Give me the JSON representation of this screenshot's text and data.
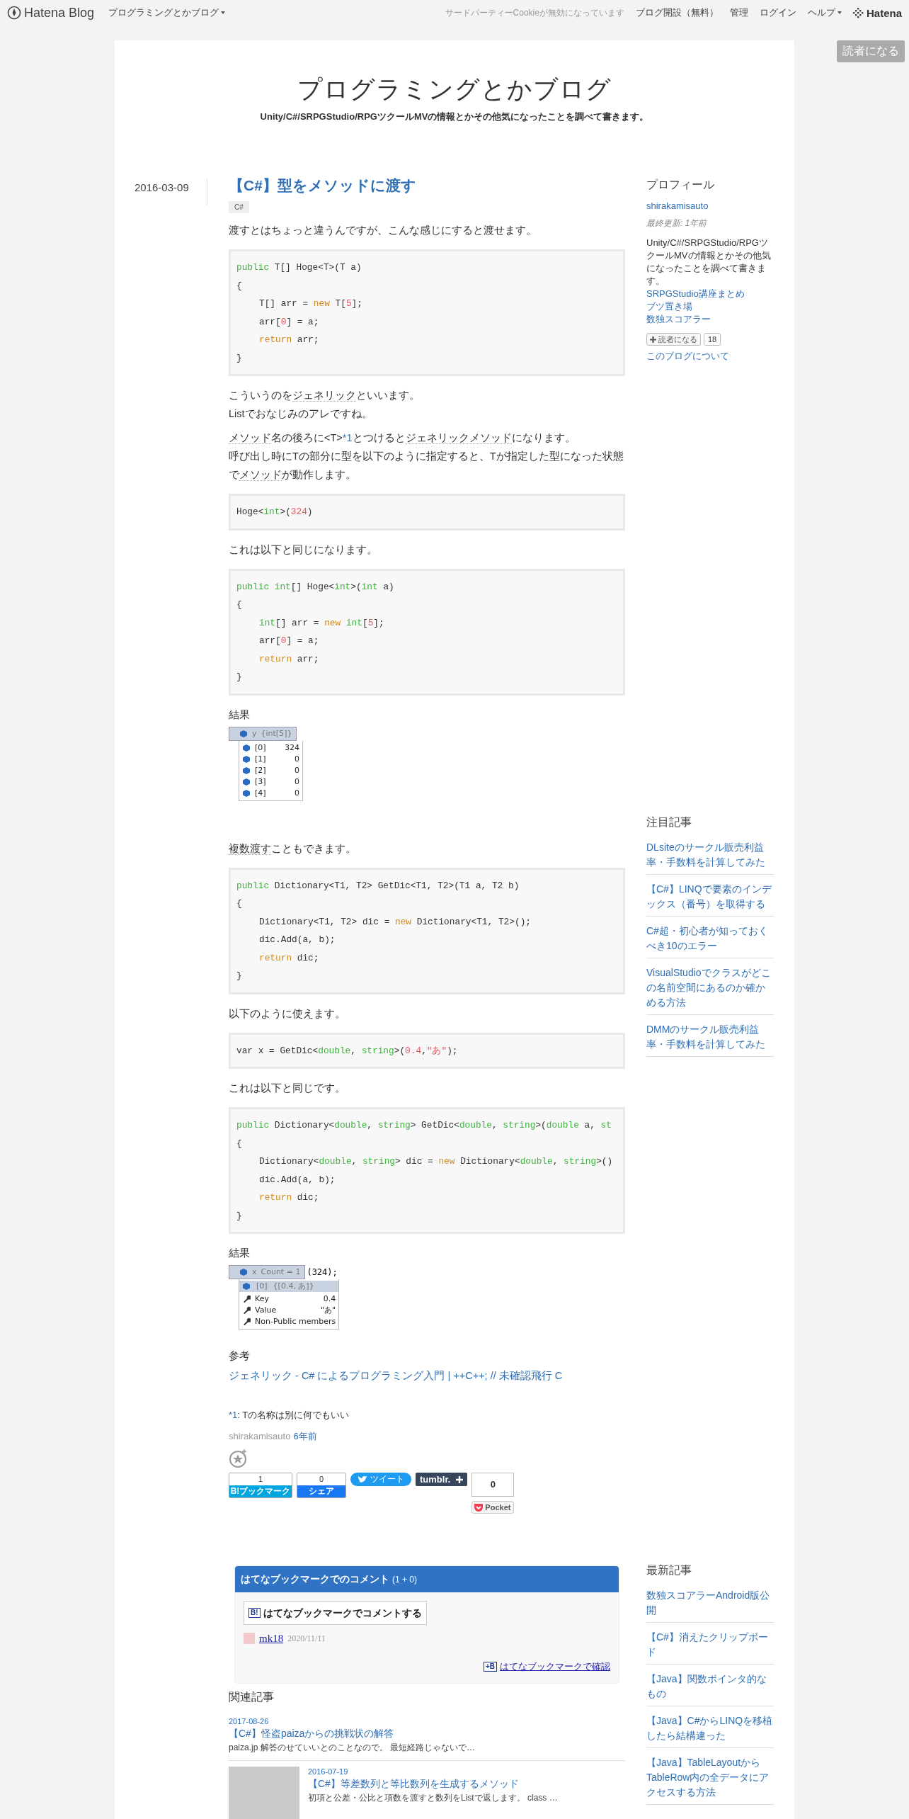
{
  "top_bar": {
    "logo": "Hatena Blog",
    "blog_menu": "プログラミングとかブログ",
    "notice": "サードパーティーCookieが無効になっています",
    "links": [
      "ブログ開設（無料）",
      "管理",
      "ログイン"
    ],
    "help": "ヘルプ",
    "brand": "Hatena"
  },
  "subscribe_button": "読者になる",
  "blog": {
    "title": "プログラミングとかブログ",
    "description": "Unity/C#/SRPGStudio/RPGツクールMVの情報とかその他気になったことを調べて書きます。"
  },
  "article": {
    "date": "2016-03-09",
    "title": "【C#】型をメソッドに渡す",
    "category": "C#",
    "body": [
      {
        "kind": "para",
        "lines": [
          [
            {
              "t": "渡すとはちょっと違うんですが、こんな感じにすると渡せます。",
              "kind": "plain"
            }
          ]
        ]
      },
      {
        "kind": "code",
        "lines": [
          {
            "indented": false,
            "tokens": [
              {
                "t": "public ",
                "kind": "kw"
              },
              {
                "t": "T[] Hoge<T>(T a)",
                "kind": "plain"
              }
            ]
          },
          {
            "indented": false,
            "tokens": [
              {
                "t": "{",
                "kind": "plain"
              }
            ]
          },
          {
            "indented": true,
            "tokens": [
              {
                "t": "T[] arr = ",
                "kind": "plain"
              },
              {
                "t": "new ",
                "kind": "ctl"
              },
              {
                "t": "T[",
                "kind": "plain"
              },
              {
                "t": "5",
                "kind": "num"
              },
              {
                "t": "];",
                "kind": "plain"
              }
            ]
          },
          {
            "indented": true,
            "tokens": [
              {
                "t": "arr[",
                "kind": "plain"
              },
              {
                "t": "0",
                "kind": "num"
              },
              {
                "t": "] = a;",
                "kind": "plain"
              }
            ]
          },
          {
            "indented": true,
            "tokens": [
              {
                "t": "return ",
                "kind": "ctl"
              },
              {
                "t": "arr;",
                "kind": "plain"
              }
            ]
          },
          {
            "indented": false,
            "tokens": [
              {
                "t": "}",
                "kind": "plain"
              }
            ]
          }
        ]
      },
      {
        "kind": "para",
        "lines": [
          [
            {
              "t": "こういうのを",
              "kind": "plain"
            },
            {
              "t": "ジェネリック",
              "kind": "keyword"
            },
            {
              "t": "といいます。",
              "kind": "plain"
            }
          ],
          [
            {
              "t": "Listでおなじみのアレですね。",
              "kind": "plain"
            }
          ]
        ]
      },
      {
        "kind": "para",
        "lines": [
          [
            {
              "t": "メソッド",
              "kind": "keyword"
            },
            {
              "t": "名の後ろに<T>",
              "kind": "plain"
            },
            {
              "t": "*1",
              "kind": "footnote"
            },
            {
              "t": "とつけると",
              "kind": "plain"
            },
            {
              "t": "ジェネリックメソッド",
              "kind": "keyword"
            },
            {
              "t": "になります。",
              "kind": "plain"
            }
          ],
          [
            {
              "t": "呼び出し時にTの部分に型を以下のように指定すると、Tが指定した型になった状態で",
              "kind": "plain"
            },
            {
              "t": "メソッド",
              "kind": "keyword"
            },
            {
              "t": "が動作します。",
              "kind": "plain"
            }
          ]
        ]
      },
      {
        "kind": "code",
        "lines": [
          {
            "indented": false,
            "tokens": [
              {
                "t": "Hoge<",
                "kind": "plain"
              },
              {
                "t": "int",
                "kind": "kw"
              },
              {
                "t": ">(",
                "kind": "plain"
              },
              {
                "t": "324",
                "kind": "num"
              },
              {
                "t": ")",
                "kind": "plain"
              }
            ]
          }
        ]
      },
      {
        "kind": "para",
        "lines": [
          [
            {
              "t": "これは以下と同じになります。",
              "kind": "plain"
            }
          ]
        ]
      },
      {
        "kind": "code",
        "lines": [
          {
            "indented": false,
            "tokens": [
              {
                "t": "public ",
                "kind": "kw"
              },
              {
                "t": "int",
                "kind": "kw"
              },
              {
                "t": "[] Hoge<",
                "kind": "plain"
              },
              {
                "t": "int",
                "kind": "kw"
              },
              {
                "t": ">(",
                "kind": "plain"
              },
              {
                "t": "int",
                "kind": "kw"
              },
              {
                "t": " a)",
                "kind": "plain"
              }
            ]
          },
          {
            "indented": false,
            "tokens": [
              {
                "t": "{",
                "kind": "plain"
              }
            ]
          },
          {
            "indented": true,
            "tokens": [
              {
                "t": "int",
                "kind": "kw"
              },
              {
                "t": "[] arr = ",
                "kind": "plain"
              },
              {
                "t": "new ",
                "kind": "ctl"
              },
              {
                "t": "int",
                "kind": "kw"
              },
              {
                "t": "[",
                "kind": "plain"
              },
              {
                "t": "5",
                "kind": "num"
              },
              {
                "t": "];",
                "kind": "plain"
              }
            ]
          },
          {
            "indented": true,
            "tokens": [
              {
                "t": "arr[",
                "kind": "plain"
              },
              {
                "t": "0",
                "kind": "num"
              },
              {
                "t": "] = a;",
                "kind": "plain"
              }
            ]
          },
          {
            "indented": true,
            "tokens": [
              {
                "t": "return ",
                "kind": "ctl"
              },
              {
                "t": "arr;",
                "kind": "plain"
              }
            ]
          },
          {
            "indented": false,
            "tokens": [
              {
                "t": "}",
                "kind": "plain"
              }
            ]
          }
        ]
      },
      {
        "kind": "label",
        "text": "結果"
      },
      {
        "kind": "debug",
        "header": {
          "name": "y",
          "value": "{int[5]}"
        },
        "rows": [
          {
            "name": "[0]",
            "value": "324"
          },
          {
            "name": "[1]",
            "value": "0"
          },
          {
            "name": "[2]",
            "value": "0"
          },
          {
            "name": "[3]",
            "value": "0"
          },
          {
            "name": "[4]",
            "value": "0"
          }
        ]
      },
      {
        "kind": "para",
        "lines": [
          [
            {
              "t": "複数渡す",
              "kind": "keyword"
            },
            {
              "t": "こともできます。",
              "kind": "plain"
            }
          ]
        ]
      },
      {
        "kind": "code",
        "lines": [
          {
            "indented": false,
            "tokens": [
              {
                "t": "public ",
                "kind": "kw"
              },
              {
                "t": "Dictionary<T1, T2> GetDic<T1, T2>(T1 a, T2 b)",
                "kind": "plain"
              }
            ]
          },
          {
            "indented": false,
            "tokens": [
              {
                "t": "{",
                "kind": "plain"
              }
            ]
          },
          {
            "indented": true,
            "tokens": [
              {
                "t": "Dictionary<T1, T2> dic = ",
                "kind": "plain"
              },
              {
                "t": "new ",
                "kind": "ctl"
              },
              {
                "t": "Dictionary<T1, T2>();",
                "kind": "plain"
              }
            ]
          },
          {
            "indented": true,
            "tokens": [
              {
                "t": "dic.Add(a, b);",
                "kind": "plain"
              }
            ]
          },
          {
            "indented": true,
            "tokens": [
              {
                "t": "return ",
                "kind": "ctl"
              },
              {
                "t": "dic;",
                "kind": "plain"
              }
            ]
          },
          {
            "indented": false,
            "tokens": [
              {
                "t": "}",
                "kind": "plain"
              }
            ]
          }
        ]
      },
      {
        "kind": "para",
        "lines": [
          [
            {
              "t": "以下のように使えます。",
              "kind": "plain"
            }
          ]
        ]
      },
      {
        "kind": "code",
        "lines": [
          {
            "indented": false,
            "tokens": [
              {
                "t": "var x = GetDic<",
                "kind": "plain"
              },
              {
                "t": "double",
                "kind": "kw"
              },
              {
                "t": ", ",
                "kind": "plain"
              },
              {
                "t": "string",
                "kind": "kw"
              },
              {
                "t": ">(",
                "kind": "plain"
              },
              {
                "t": "0.4",
                "kind": "num"
              },
              {
                "t": ",",
                "kind": "plain"
              },
              {
                "t": "\"あ\"",
                "kind": "num"
              },
              {
                "t": ");",
                "kind": "plain"
              }
            ]
          }
        ]
      },
      {
        "kind": "para",
        "lines": [
          [
            {
              "t": "これは以下と同じです。",
              "kind": "plain"
            }
          ]
        ]
      },
      {
        "kind": "code",
        "lines": [
          {
            "indented": false,
            "tokens": [
              {
                "t": "public ",
                "kind": "kw"
              },
              {
                "t": "Dictionary<",
                "kind": "plain"
              },
              {
                "t": "double",
                "kind": "kw"
              },
              {
                "t": ", ",
                "kind": "plain"
              },
              {
                "t": "string",
                "kind": "kw"
              },
              {
                "t": "> GetDic<",
                "kind": "plain"
              },
              {
                "t": "double",
                "kind": "kw"
              },
              {
                "t": ", ",
                "kind": "plain"
              },
              {
                "t": "string",
                "kind": "kw"
              },
              {
                "t": ">(",
                "kind": "plain"
              },
              {
                "t": "double",
                "kind": "kw"
              },
              {
                "t": " a, ",
                "kind": "plain"
              },
              {
                "t": "st",
                "kind": "kw"
              }
            ]
          },
          {
            "indented": false,
            "tokens": [
              {
                "t": "{",
                "kind": "plain"
              }
            ]
          },
          {
            "indented": true,
            "tokens": [
              {
                "t": "Dictionary<",
                "kind": "plain"
              },
              {
                "t": "double",
                "kind": "kw"
              },
              {
                "t": ", ",
                "kind": "plain"
              },
              {
                "t": "string",
                "kind": "kw"
              },
              {
                "t": "> dic = ",
                "kind": "plain"
              },
              {
                "t": "new ",
                "kind": "ctl"
              },
              {
                "t": "Dictionary<",
                "kind": "plain"
              },
              {
                "t": "double",
                "kind": "kw"
              },
              {
                "t": ", ",
                "kind": "plain"
              },
              {
                "t": "string",
                "kind": "kw"
              },
              {
                "t": ">()",
                "kind": "plain"
              }
            ]
          },
          {
            "indented": true,
            "tokens": [
              {
                "t": "dic.Add(a, b);",
                "kind": "plain"
              }
            ]
          },
          {
            "indented": true,
            "tokens": [
              {
                "t": "return ",
                "kind": "ctl"
              },
              {
                "t": "dic;",
                "kind": "plain"
              }
            ]
          },
          {
            "indented": false,
            "tokens": [
              {
                "t": "}",
                "kind": "plain"
              }
            ]
          }
        ]
      },
      {
        "kind": "label",
        "text": "結果"
      },
      {
        "kind": "debug",
        "header": {
          "name": "x",
          "value": "Count = 1"
        },
        "trail": "(324);",
        "sub": {
          "name": "[0]",
          "value": "{[0.4, あ]}"
        },
        "rows": [
          {
            "name": "Key",
            "value": "0.4"
          },
          {
            "name": "Value",
            "value": "\"あ\""
          },
          {
            "name": "Non-Public members"
          }
        ]
      },
      {
        "kind": "label",
        "text": "参考"
      },
      {
        "kind": "link",
        "text": "ジェネリック - C# によるプログラミング入門 | ++C++; // 未確認飛行 C"
      }
    ],
    "footnote": {
      "mark": "*1",
      "text": ": Tの名称は別に何でもいい"
    },
    "author": "shirakamisauto",
    "posted": "6年前",
    "share": {
      "bookmark_count": "1",
      "bookmark_label": "B!ブックマーク",
      "facebook_count": "0",
      "facebook_label": "シェア",
      "tweet": "ツイート",
      "tumblr": "tumblr.",
      "pocket_count": "0",
      "pocket_label": "Pocket"
    }
  },
  "comments": {
    "title": "はてなブックマークでのコメント",
    "count": "(1 + 0)",
    "button_badge": "B!",
    "button": "はてなブックマークでコメントする",
    "items": [
      {
        "user": "mk18",
        "date": "2020/11/11"
      }
    ],
    "confirm_badge": "+B",
    "confirm": "はてなブックマークで確認"
  },
  "related": {
    "title": "関連記事",
    "items": [
      {
        "date": "2017-08-26",
        "title": "【C#】怪盗paizaからの挑戦状の解答",
        "snippet": "paiza.jp 解答のせていいとのことなので。 最短経路じゃないで…",
        "thumbnail": false
      },
      {
        "date": "2016-07-19",
        "title": "【C#】等差数列と等比数列を生成するメソッド",
        "snippet": "初項と公差・公比と項数を渡すと数列をListで返します。 class …",
        "thumbnail": true
      }
    ]
  },
  "sidebar": {
    "profile": {
      "title": "プロフィール",
      "name": "shirakamisauto",
      "updated": "最終更新: 1年前",
      "description": "Unity/C#/SRPGStudio/RPGツクールMVの情報とかその他気になったことを調べて書きます。",
      "links": [
        "SRPGStudio講座まとめ",
        "ブツ置き場",
        "数独スコアラー"
      ],
      "subscribe": "読者になる",
      "subscribers": "18",
      "about": "このブログについて"
    },
    "featured": {
      "title": "注目記事",
      "items": [
        "DLsiteのサークル販売利益率・手数料を計算してみた",
        "【C#】LINQで要素のインデックス（番号）を取得する",
        "C#超・初心者が知っておくべき10のエラー",
        "VisualStudioでクラスがどこの名前空間にあるのか確かめる方法",
        "DMMのサークル販売利益率・手数料を計算してみた"
      ]
    },
    "recent": {
      "title": "最新記事",
      "items": [
        "数独スコアラーAndroid版公開",
        "【C#】消えたクリップボード",
        "【Java】関数ポインタ的なもの",
        "【Java】C#からLINQを移植したら結構違った",
        "【Java】TableLayoutからTableRow内の全データにアクセスする方法"
      ]
    }
  }
}
